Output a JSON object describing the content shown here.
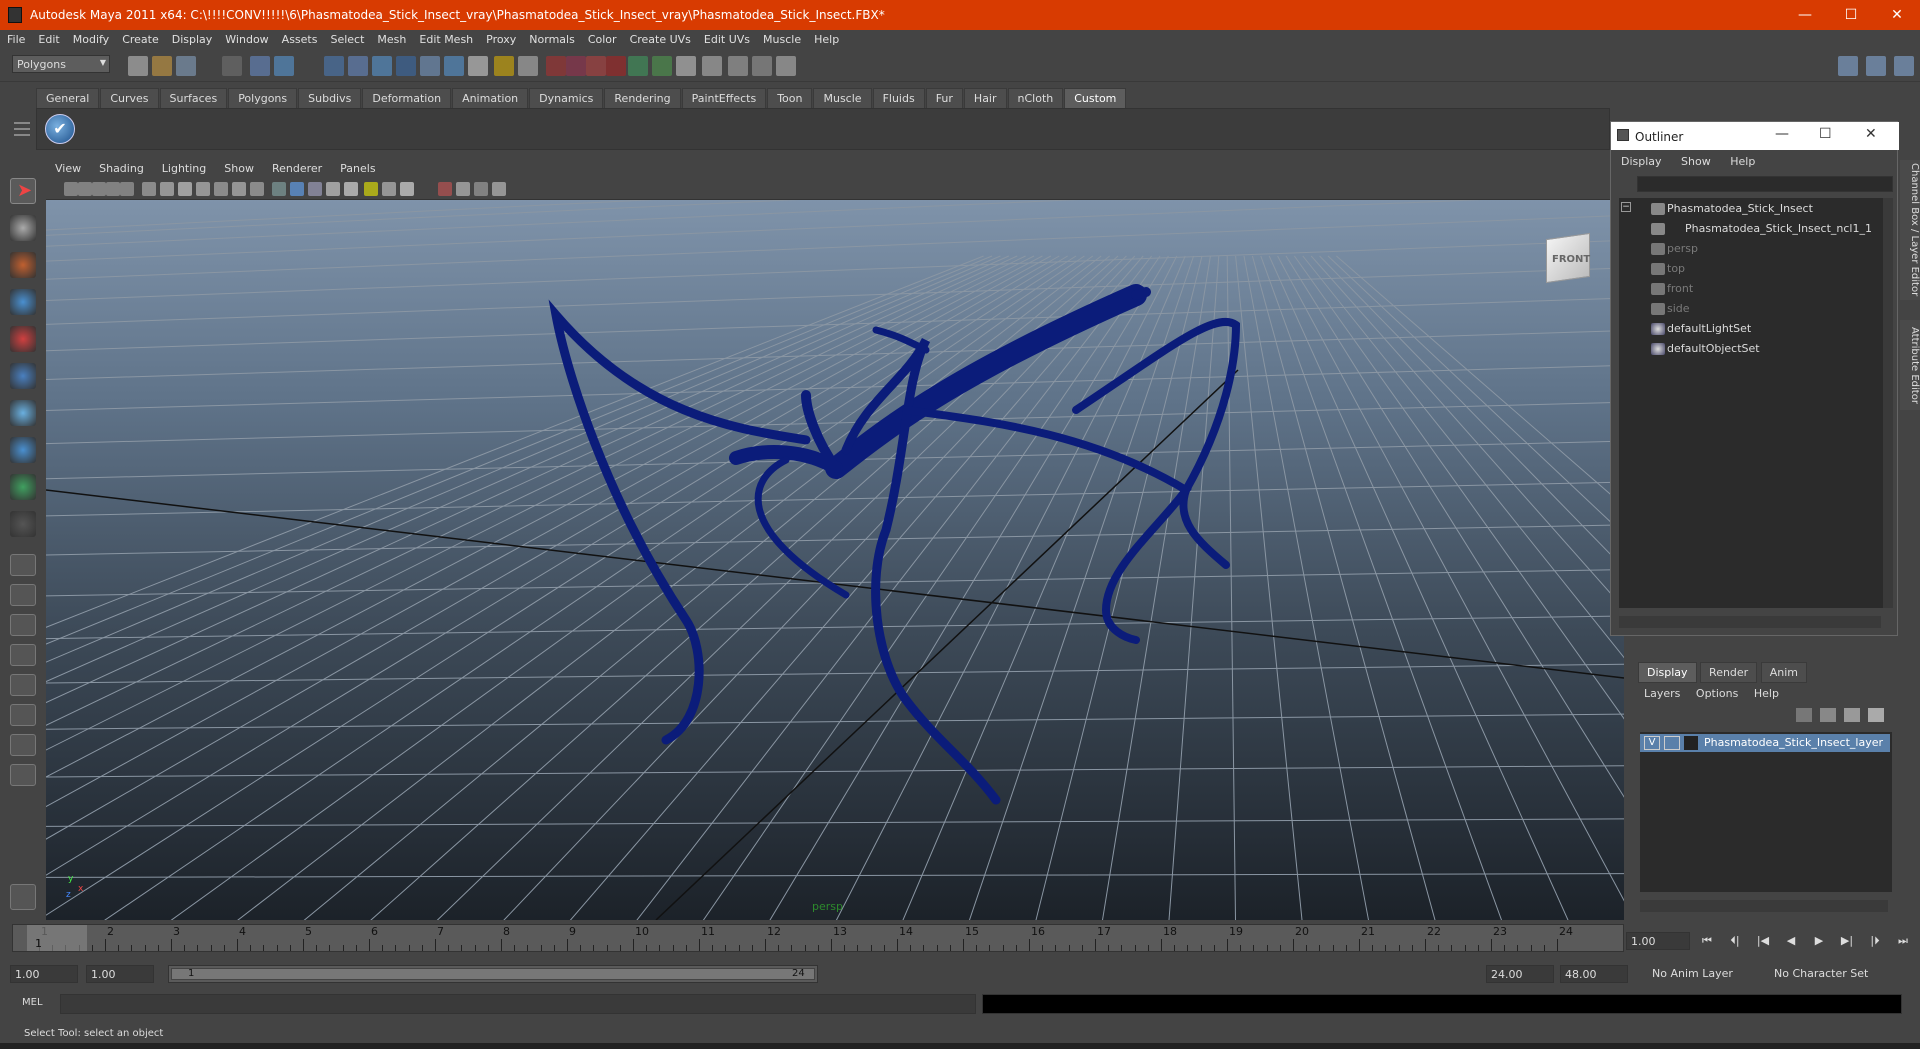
{
  "window": {
    "title": "Autodesk Maya 2011 x64: C:\\!!!!CONV!!!!!\\6\\Phasmatodea_Stick_Insect_vray\\Phasmatodea_Stick_Insect_vray\\Phasmatodea_Stick_Insect.FBX*",
    "minimize": "—",
    "maximize": "☐",
    "close": "✕"
  },
  "menubar": [
    "File",
    "Edit",
    "Modify",
    "Create",
    "Display",
    "Window",
    "Assets",
    "Select",
    "Mesh",
    "Edit Mesh",
    "Proxy",
    "Normals",
    "Color",
    "Create UVs",
    "Edit UVs",
    "Muscle",
    "Help"
  ],
  "statusline": {
    "mode": "Polygons"
  },
  "shelf": {
    "tabs": [
      "General",
      "Curves",
      "Surfaces",
      "Polygons",
      "Subdivs",
      "Deformation",
      "Animation",
      "Dynamics",
      "Rendering",
      "PaintEffects",
      "Toon",
      "Muscle",
      "Fluids",
      "Fur",
      "Hair",
      "nCloth",
      "Custom"
    ],
    "active_tab": "Custom",
    "icon": "✔"
  },
  "viewport": {
    "menus": [
      "View",
      "Shading",
      "Lighting",
      "Show",
      "Renderer",
      "Panels"
    ],
    "camera_label": "persp",
    "viewcube_label": "FRONT",
    "axis_x": "x",
    "axis_y": "y",
    "axis_z": "z"
  },
  "outliner": {
    "title": "Outliner",
    "menus": [
      "Display",
      "Show",
      "Help"
    ],
    "items": [
      {
        "label": "Phasmatodea_Stick_Insect",
        "dim": false
      },
      {
        "label": "Phasmatodea_Stick_Insect_ncl1_1",
        "dim": false
      },
      {
        "label": "persp",
        "dim": true
      },
      {
        "label": "top",
        "dim": true
      },
      {
        "label": "front",
        "dim": true
      },
      {
        "label": "side",
        "dim": true
      },
      {
        "label": "defaultLightSet",
        "dim": false
      },
      {
        "label": "defaultObjectSet",
        "dim": false
      }
    ]
  },
  "side_tabs": [
    "Channel Box / Layer Editor",
    "Attribute Editor"
  ],
  "layer_editor": {
    "tabs": [
      "Display",
      "Render",
      "Anim"
    ],
    "active_tab": "Display",
    "menus": [
      "Layers",
      "Options",
      "Help"
    ],
    "layer": {
      "visible": "V",
      "name": "Phasmatodea_Stick_Insect_layer"
    }
  },
  "timeline": {
    "ticks": [
      "1",
      "2",
      "3",
      "4",
      "5",
      "6",
      "7",
      "8",
      "9",
      "10",
      "11",
      "12",
      "13",
      "14",
      "15",
      "16",
      "17",
      "18",
      "19",
      "20",
      "21",
      "22",
      "23",
      "24"
    ],
    "current_marker": "1",
    "current_frame": "1.00",
    "playback_buttons": [
      "⏮",
      "⏴|",
      "|◀",
      "◀",
      "▶",
      "▶|",
      "|⏵",
      "⏭"
    ]
  },
  "range": {
    "start": "1.00",
    "anim_start": "1.00",
    "slider_start": "1",
    "slider_end": "24",
    "anim_end": "24.00",
    "end": "48.00",
    "anim_layer": "No Anim Layer",
    "character_set": "No Character Set"
  },
  "command": {
    "label": "MEL"
  },
  "help": {
    "text": "Select Tool: select an object"
  }
}
